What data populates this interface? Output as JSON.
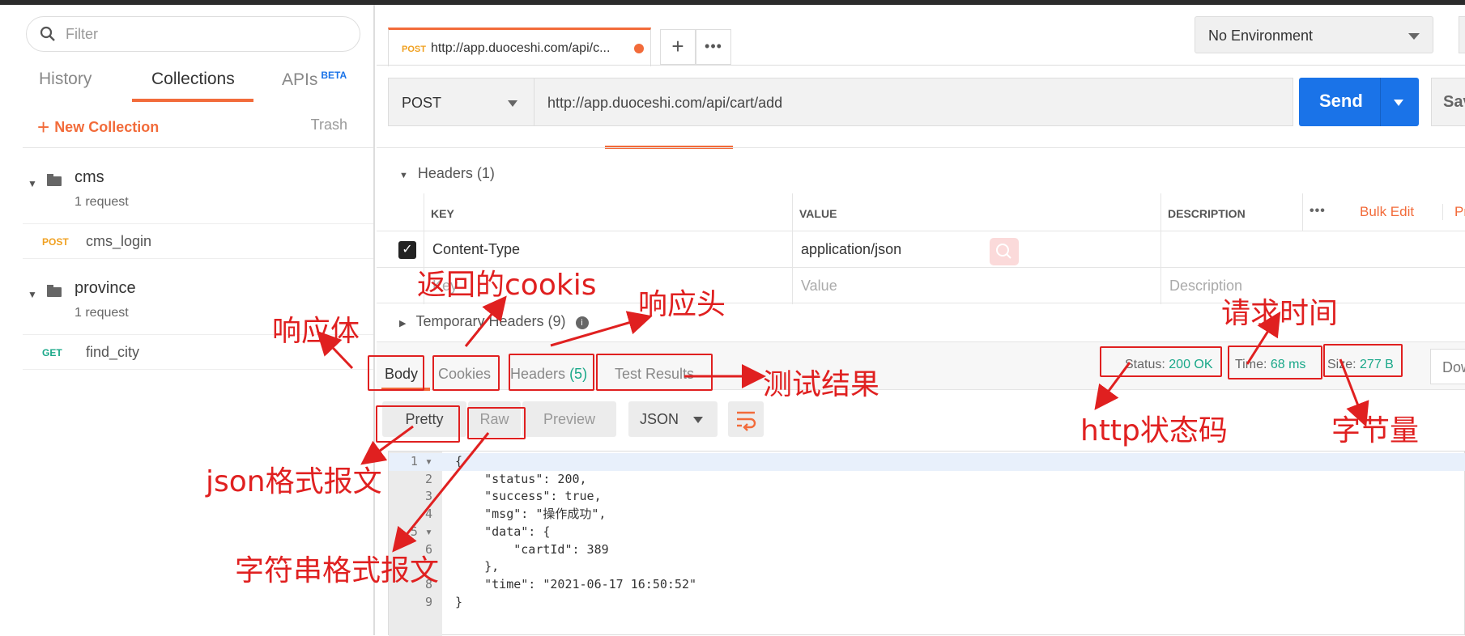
{
  "sidebar": {
    "filter_placeholder": "Filter",
    "tabs": [
      "History",
      "Collections",
      "APIs"
    ],
    "beta": "BETA",
    "new_collection": "New Collection",
    "trash": "Trash",
    "collections": [
      {
        "name": "cms",
        "count": "1 request",
        "request": {
          "method": "POST",
          "name": "cms_login"
        }
      },
      {
        "name": "province",
        "count": "1 request",
        "request": {
          "method": "GET",
          "name": "find_city"
        }
      }
    ]
  },
  "request": {
    "tab_method": "POST",
    "tab_url": "http://app.duoceshi.com/api/c...",
    "environment": "No Environment",
    "method": "POST",
    "url": "http://app.duoceshi.com/api/cart/add",
    "send": "Send",
    "save": "Sav",
    "headers_title": "Headers (1)",
    "headers_columns": [
      "KEY",
      "VALUE",
      "DESCRIPTION"
    ],
    "bulk_edit": "Bulk Edit",
    "presets": "Pre",
    "header_row": {
      "key": "Content-Type",
      "value": "application/json",
      "description": ""
    },
    "placeholder_row": {
      "key": "Key",
      "value": "Value",
      "description": "Description"
    },
    "temp_headers": "Temporary Headers (9)"
  },
  "response": {
    "tabs": [
      "Body",
      "Cookies",
      "Headers",
      "Test Results"
    ],
    "headers_count": "(5)",
    "status_label": "Status:",
    "status_value": "200 OK",
    "time_label": "Time:",
    "time_value": "68 ms",
    "size_label": "Size:",
    "size_value": "277 B",
    "download": "Dow",
    "formats": [
      "Pretty",
      "Raw",
      "Preview"
    ],
    "language": "JSON",
    "code_lines": [
      "{",
      "    \"status\": 200,",
      "    \"success\": true,",
      "    \"msg\": \"操作成功\",",
      "    \"data\": {",
      "        \"cartId\": 389",
      "    },",
      "    \"time\": \"2021-06-17 16:50:52\"",
      "}"
    ]
  },
  "annotations": {
    "cookies": "返回的cookis",
    "body": "响应体",
    "headers": "响应头",
    "test_results": "测试结果",
    "request_time": "请求时间",
    "status_code": "http状态码",
    "size": "字节量",
    "pretty": "json格式报文",
    "raw": "字符串格式报文"
  },
  "colors": {
    "accent": "#f26b3a",
    "send_blue": "#1a73e8",
    "status_green": "#1aa889",
    "annotation_red": "#e02020"
  }
}
